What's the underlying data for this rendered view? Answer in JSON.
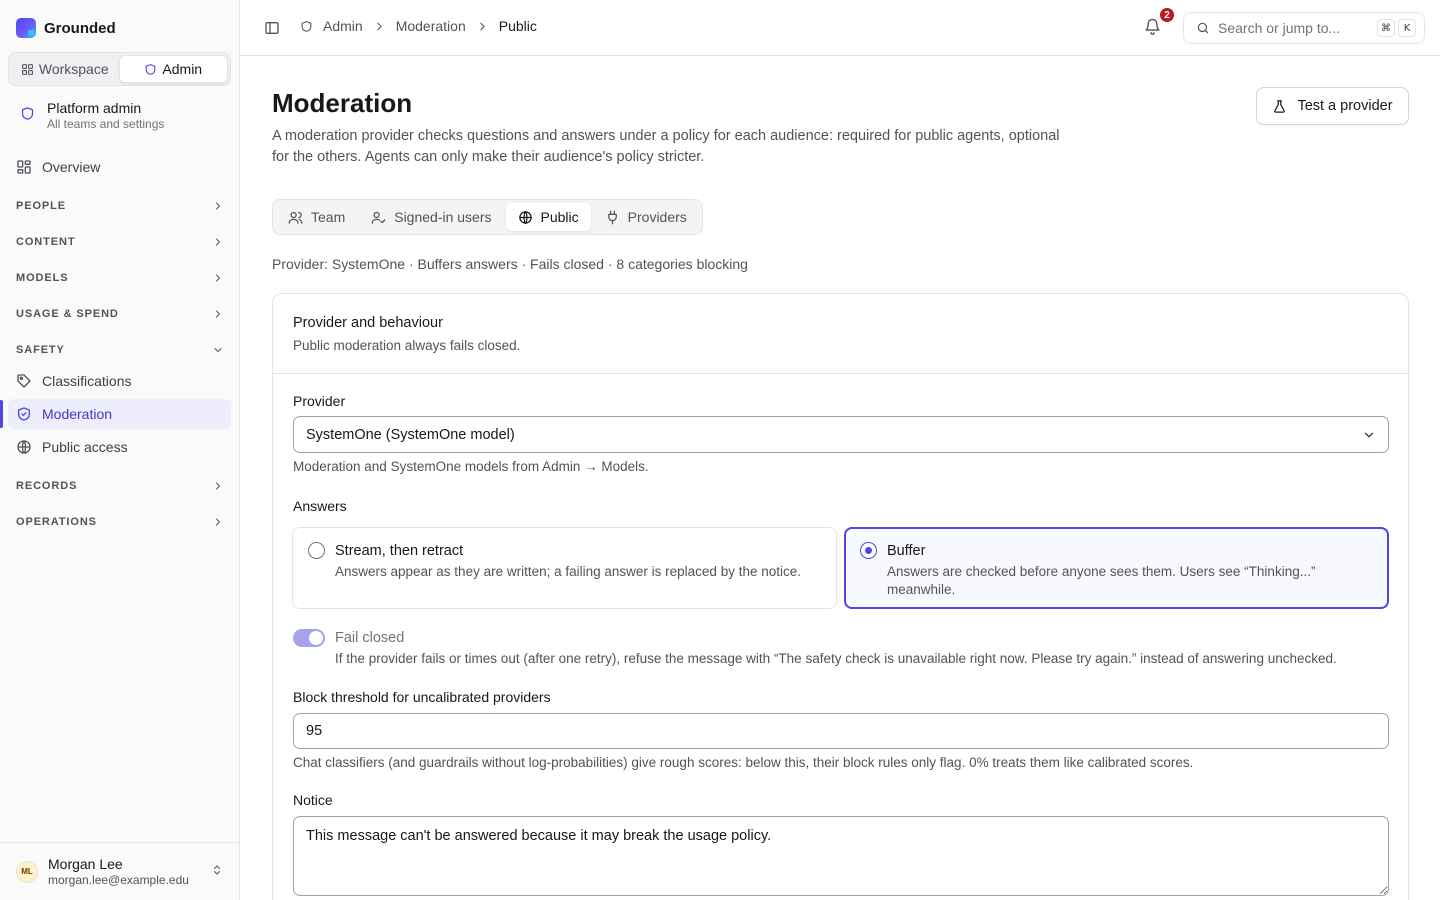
{
  "app": {
    "name": "Grounded",
    "brand_color": "#4f46e5"
  },
  "switcher": {
    "workspace": "Workspace",
    "admin": "Admin",
    "active": "admin"
  },
  "scope": {
    "title": "Platform admin",
    "subtitle": "All teams and settings"
  },
  "sidebar": {
    "overview": "Overview",
    "groups": {
      "people": "PEOPLE",
      "content": "CONTENT",
      "models": "MODELS",
      "usage": "USAGE & SPEND",
      "safety": "SAFETY",
      "records": "RECORDS",
      "operations": "OPERATIONS"
    },
    "safety_items": [
      "Classifications",
      "Moderation",
      "Public access"
    ],
    "active_item": "Moderation"
  },
  "user": {
    "initials": "ML",
    "name": "Morgan Lee",
    "email": "morgan.lee@example.edu"
  },
  "topbar": {
    "breadcrumb": [
      "Admin",
      "Moderation",
      "Public"
    ],
    "notifications_count": "2",
    "search_placeholder": "Search or jump to...",
    "search_kbd": [
      "⌘",
      "K"
    ]
  },
  "page": {
    "title": "Moderation",
    "description": "A moderation provider checks questions and answers under a policy for each audience: required for public agents, optional for the others. Agents can only make their audience's policy stricter.",
    "test_button": "Test a provider",
    "tabs": [
      "Team",
      "Signed-in users",
      "Public",
      "Providers"
    ],
    "active_tab": "Public",
    "summary": "Provider: SystemOne · Buffers answers · Fails closed · 8 categories blocking"
  },
  "card": {
    "title": "Provider and behaviour",
    "subtitle": "Public moderation always fails closed.",
    "provider": {
      "label": "Provider",
      "value": "SystemOne (SystemOne model)",
      "help": "Moderation and SystemOne models from Admin → Models."
    },
    "answers": {
      "label": "Answers",
      "options": [
        {
          "title": "Stream, then retract",
          "desc": "Answers appear as they are written; a failing answer is replaced by the notice.",
          "selected": false
        },
        {
          "title": "Buffer",
          "desc": "Answers are checked before anyone sees them. Users see “Thinking...” meanwhile.",
          "selected": true
        }
      ]
    },
    "fail_closed": {
      "label": "Fail closed",
      "enabled": true,
      "desc": "If the provider fails or times out (after one retry), refuse the message with “The safety check is unavailable right now. Please try again.” instead of answering unchecked."
    },
    "threshold": {
      "label": "Block threshold for uncalibrated providers",
      "value": "95",
      "help": "Chat classifiers (and guardrails without log-probabilities) give rough scores: below this, their block rules only flag. 0% treats them like calibrated scores."
    },
    "notice": {
      "label": "Notice",
      "value": "This message can't be answered because it may break the usage policy."
    }
  }
}
